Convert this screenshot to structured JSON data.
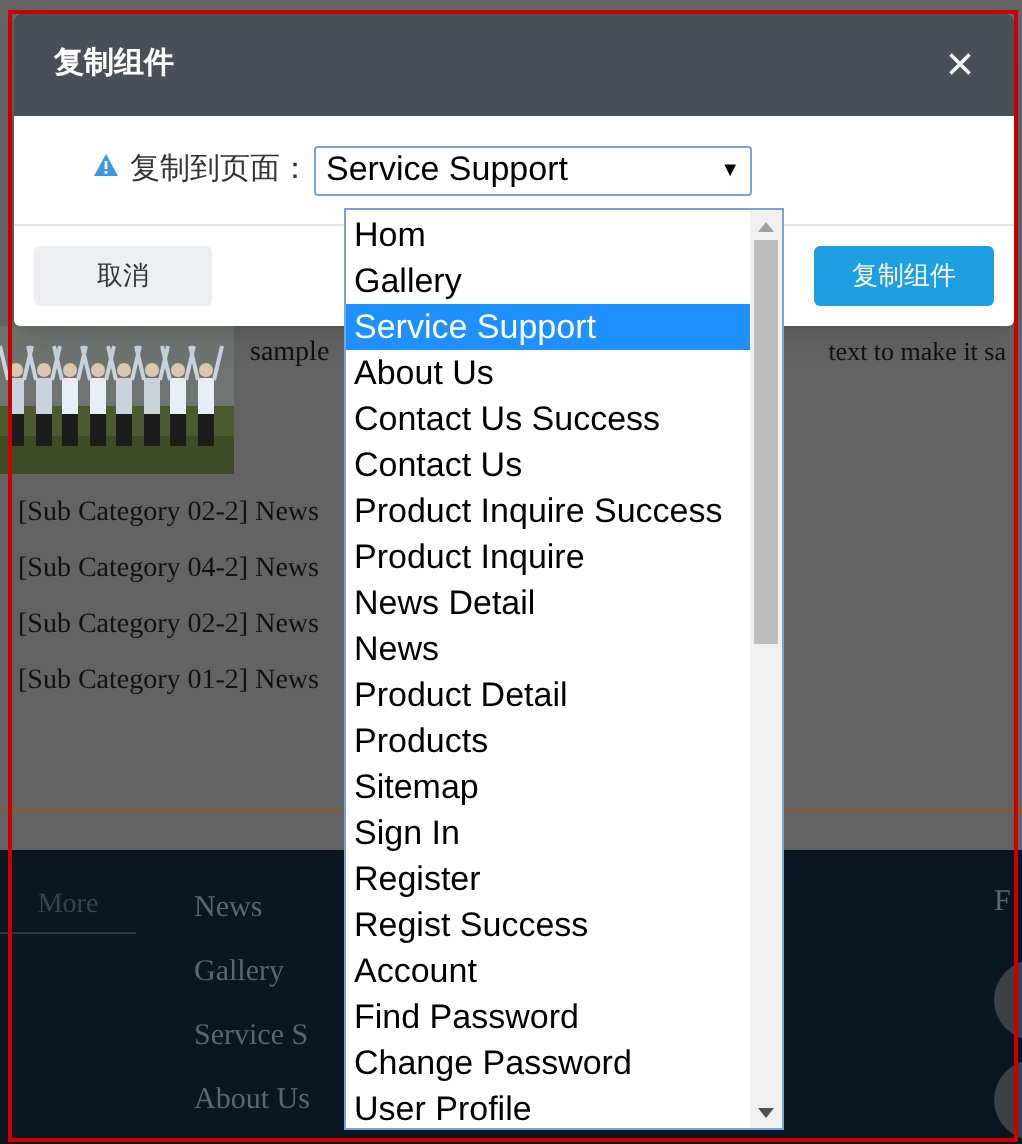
{
  "page": {
    "sample_text": "sample",
    "text_right": "text to make it sa",
    "news": [
      "[Sub Category 02-2] News",
      "[Sub Category 04-2] News",
      "[Sub Category 02-2] News",
      "[Sub Category 01-2] News"
    ],
    "footer": {
      "more": "More",
      "links": [
        "News",
        "Gallery",
        "Service S",
        "About Us"
      ],
      "column_3_heading": "F"
    }
  },
  "modal": {
    "title": "复制组件",
    "close": "×",
    "label": "复制到页面：",
    "select": {
      "value": "Service Support",
      "arrow": "▼"
    },
    "options": [
      {
        "label": "Hom",
        "selected": false
      },
      {
        "label": "Gallery",
        "selected": false
      },
      {
        "label": "Service Support",
        "selected": true
      },
      {
        "label": "About Us",
        "selected": false
      },
      {
        "label": "Contact Us Success",
        "selected": false
      },
      {
        "label": "Contact Us",
        "selected": false
      },
      {
        "label": "Product Inquire Success",
        "selected": false
      },
      {
        "label": "Product Inquire",
        "selected": false
      },
      {
        "label": "News Detail",
        "selected": false
      },
      {
        "label": "News",
        "selected": false
      },
      {
        "label": "Product Detail",
        "selected": false
      },
      {
        "label": "Products",
        "selected": false
      },
      {
        "label": "Sitemap",
        "selected": false
      },
      {
        "label": "Sign In",
        "selected": false
      },
      {
        "label": "Register",
        "selected": false
      },
      {
        "label": "Regist Success",
        "selected": false
      },
      {
        "label": "Account",
        "selected": false
      },
      {
        "label": "Find Password",
        "selected": false
      },
      {
        "label": "Change Password",
        "selected": false
      },
      {
        "label": "User Profile",
        "selected": false
      }
    ],
    "buttons": {
      "cancel": "取消",
      "confirm": "复制组件"
    }
  }
}
